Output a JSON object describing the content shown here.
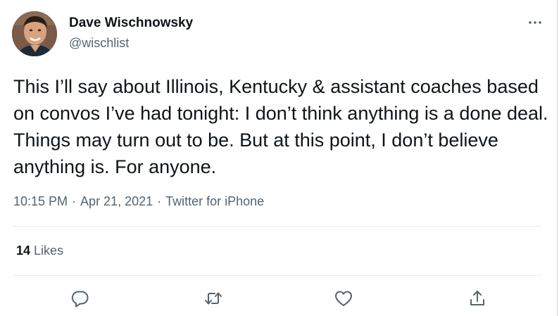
{
  "author": {
    "name": "Dave Wischnowsky",
    "handle": "@wischlist"
  },
  "tweet": {
    "text": "This I’ll say about Illinois, Kentucky & assistant coaches based on convos I’ve had tonight: I don’t think anything is a done deal. Things may turn out to be. But at this point, I don’t believe anything is. For anyone.",
    "time": "10:15 PM",
    "separator": "·",
    "date": "Apr 21, 2021",
    "source": "Twitter for iPhone"
  },
  "stats": {
    "likes_count": "14",
    "likes_label": "Likes"
  },
  "actions": [
    {
      "icon": "reply-icon"
    },
    {
      "icon": "retweet-icon"
    },
    {
      "icon": "like-icon"
    },
    {
      "icon": "share-icon"
    }
  ],
  "icons": {
    "more": "more-icon",
    "avatar": "avatar"
  },
  "colors": {
    "text": "#0f1419",
    "secondary": "#536471",
    "divider": "#e6ecf0",
    "icon": "#536471"
  }
}
